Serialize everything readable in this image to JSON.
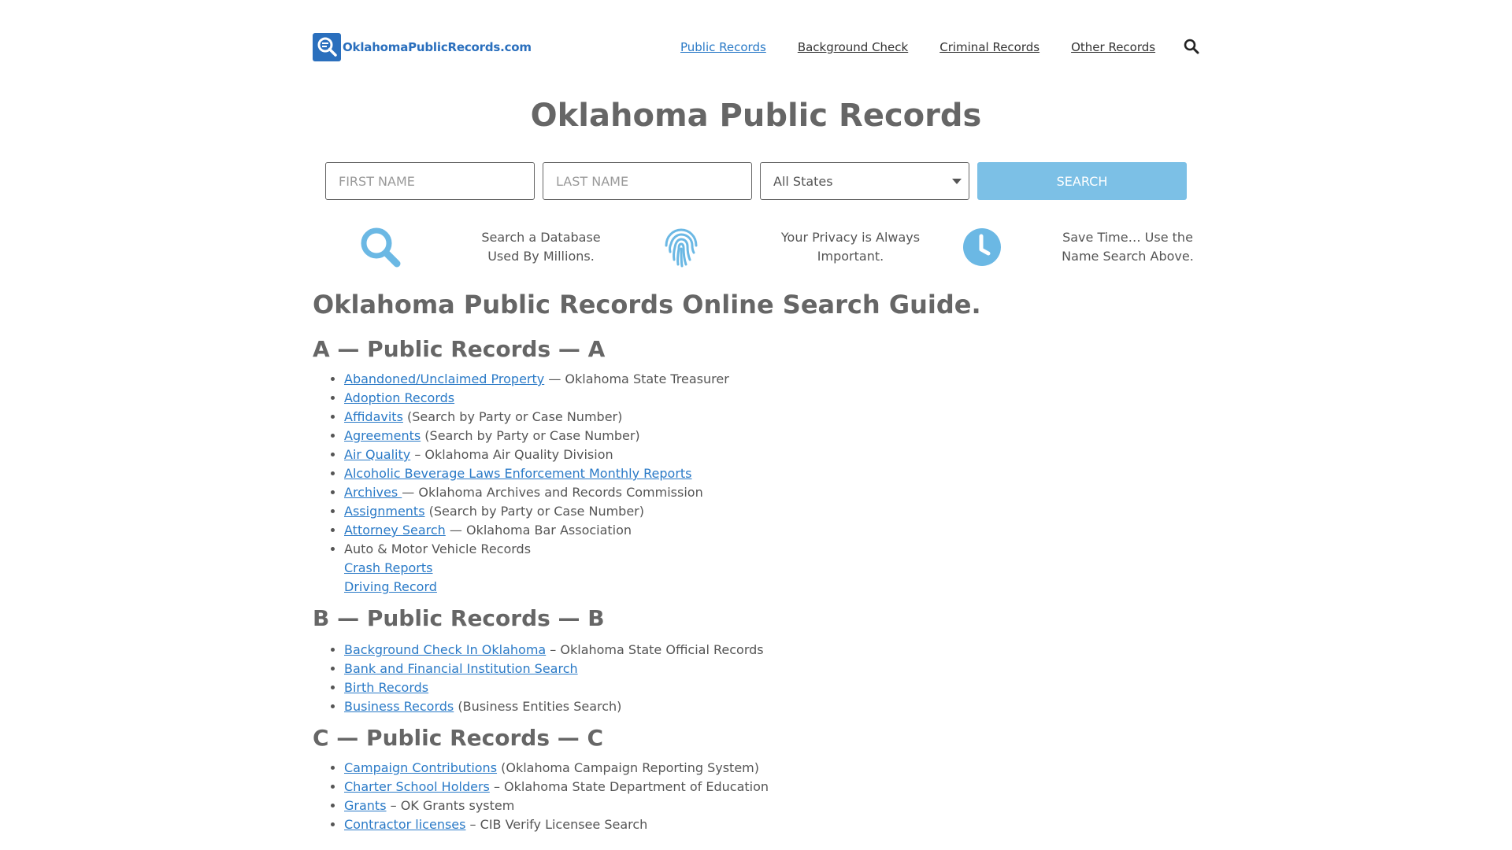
{
  "header": {
    "logo_text": "OklahomaPublicRecords.com",
    "nav": [
      {
        "label": "Public Records",
        "active": true
      },
      {
        "label": "Background Check",
        "active": false
      },
      {
        "label": "Criminal Records",
        "active": false
      },
      {
        "label": "Other Records",
        "active": false
      }
    ],
    "search_icon": "search-icon"
  },
  "title": "Oklahoma Public Records",
  "search_form": {
    "first_name_placeholder": "FIRST NAME",
    "last_name_placeholder": "LAST NAME",
    "state_selected": "All States",
    "button_label": "SEARCH"
  },
  "features": [
    {
      "icon": "search-icon",
      "line1": "Search a Database",
      "line2": "Used By Millions."
    },
    {
      "icon": "fingerprint-icon",
      "line1": "Your Privacy is Always",
      "line2": "Important."
    },
    {
      "icon": "clock-icon",
      "line1": "Save Time… Use the",
      "line2": "Name Search Above."
    }
  ],
  "guide_title": "Oklahoma Public Records Online Search Guide.",
  "sections": [
    {
      "title": "A — Public Records — A",
      "items": [
        {
          "link": "Abandoned/Unclaimed Property",
          "suffix": " — Oklahoma State Treasurer"
        },
        {
          "link": "Adoption Records",
          "suffix": ""
        },
        {
          "link": "Affidavits",
          "suffix": " (Search by Party or Case Number)"
        },
        {
          "link": "Agreements",
          "suffix": " (Search by Party or Case Number)"
        },
        {
          "link": "Air Quality",
          "suffix": " – Oklahoma Air Quality Division"
        },
        {
          "link": "Alcoholic Beverage Laws Enforcement Monthly Reports",
          "suffix": ""
        },
        {
          "link": "Archives ",
          "suffix": "— Oklahoma Archives and Records Commission"
        },
        {
          "link": "Assignments",
          "suffix": " (Search by Party or Case Number)"
        },
        {
          "link": "Attorney Search",
          "suffix": " — Oklahoma Bar Association"
        },
        {
          "text": "Auto & Motor Vehicle Records",
          "sublinks": [
            "Crash Reports",
            "Driving Record"
          ]
        }
      ]
    },
    {
      "title": "B — Public Records — B",
      "items": [
        {
          "link": "Background Check In Oklahoma",
          "suffix": " – Oklahoma State Official Records"
        },
        {
          "link": "Bank and Financial Institution Search",
          "suffix": ""
        },
        {
          "link": "Birth Records",
          "suffix": ""
        },
        {
          "link": "Business Records",
          "suffix": " (Business Entities Search)"
        }
      ]
    },
    {
      "title": "C — Public Records — C",
      "items": [
        {
          "link": "Campaign Contributions",
          "suffix": " (Oklahoma Campaign Reporting System)"
        },
        {
          "link": "Charter School Holders",
          "suffix": " – Oklahoma State Department of Education"
        },
        {
          "link": "Grants",
          "suffix": " – OK Grants system"
        },
        {
          "link": "Contractor licenses",
          "suffix": " – CIB Verify Licensee Search"
        }
      ]
    }
  ],
  "colors": {
    "brand_blue": "#2a6fbd",
    "link_blue": "#2a7ac7",
    "icon_blue": "#6bb8e4",
    "button_blue": "#7cc0e6",
    "heading_gray": "#666666"
  }
}
